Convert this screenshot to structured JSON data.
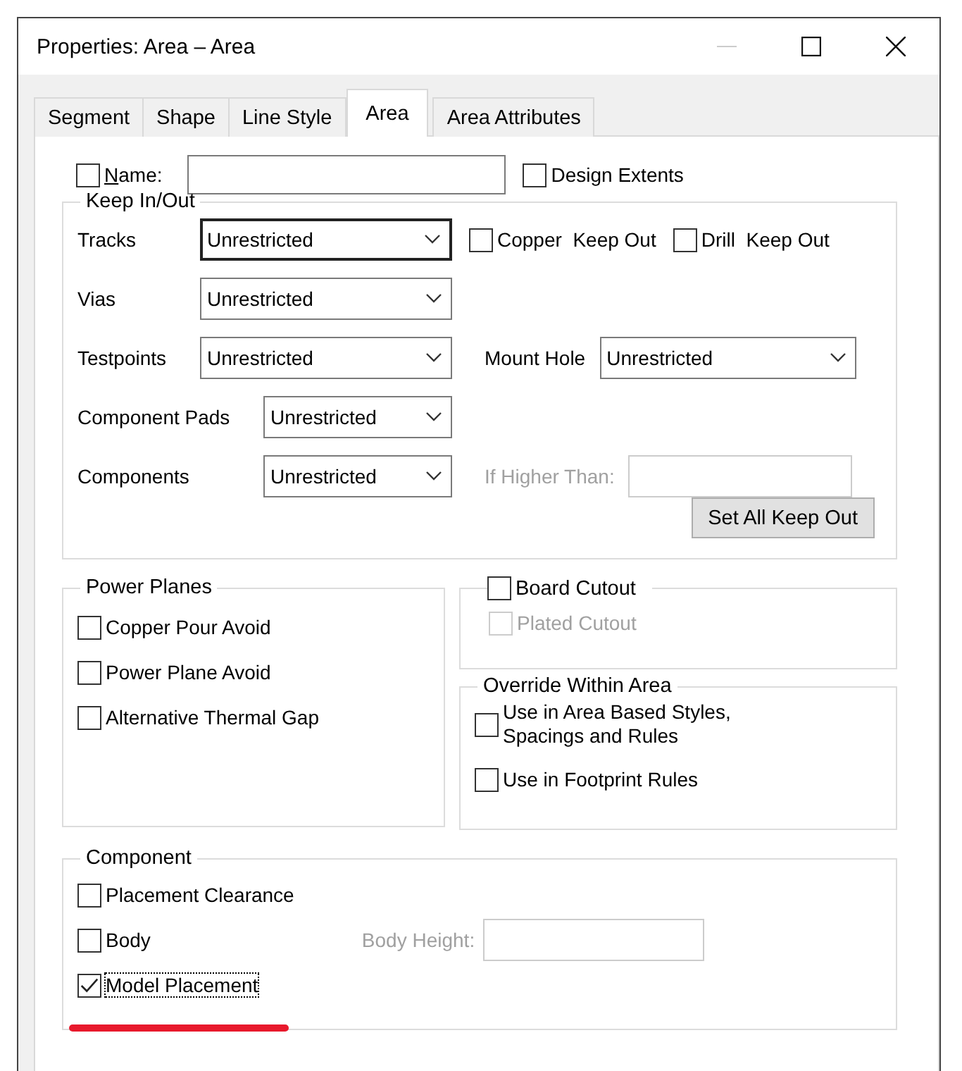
{
  "window": {
    "title": "Properties: Area – Area"
  },
  "title_buttons": [
    {
      "kind": "minimize",
      "disabled": true
    },
    {
      "kind": "maximize",
      "disabled": false
    },
    {
      "kind": "close",
      "disabled": false
    }
  ],
  "tabs": [
    {
      "label": "Segment",
      "selected": false
    },
    {
      "label": "Shape",
      "selected": false
    },
    {
      "label": "Line Style",
      "selected": false
    },
    {
      "label": "Area",
      "selected": true
    },
    {
      "label": "Area Attributes",
      "selected": false
    }
  ],
  "name_row": {
    "name": {
      "label": "Name:",
      "checked": false
    },
    "design_extents": {
      "label": "Design Extents",
      "checked": false
    }
  },
  "keep_in_out": {
    "title": "Keep In/Out",
    "rows": [
      {
        "label": "Tracks",
        "value": "Unrestricted",
        "focused": true,
        "extras": [
          {
            "kind": "checkbox",
            "label": "Copper  Keep Out",
            "checked": false
          },
          {
            "kind": "checkbox",
            "label": "Drill  Keep Out",
            "checked": false
          }
        ]
      },
      {
        "label": "Vias",
        "value": "Unrestricted",
        "focused": false
      },
      {
        "label": "Testpoints",
        "value": "Unrestricted",
        "focused": false,
        "extras": [
          {
            "kind": "combo",
            "label": "Mount Hole",
            "value": "Unrestricted"
          }
        ]
      },
      {
        "label": "Component Pads",
        "value": "Unrestricted",
        "focused": false
      },
      {
        "label": "Components",
        "value": "Unrestricted",
        "focused": false,
        "extras": [
          {
            "kind": "field",
            "label": "If Higher Than:",
            "disabled": true
          }
        ]
      }
    ],
    "button": "Set All Keep Out"
  },
  "power_planes": {
    "title": "Power Planes",
    "items": [
      {
        "label": "Copper Pour Avoid",
        "checked": false
      },
      {
        "label": "Power Plane Avoid",
        "checked": false
      },
      {
        "label": "Alternative Thermal Gap",
        "checked": false
      }
    ]
  },
  "board_cutout": {
    "label": "Board Cutout",
    "checked": false,
    "plated_cutout": {
      "label": "Plated Cutout",
      "checked": false,
      "disabled": true
    }
  },
  "override": {
    "title": "Override Within Area",
    "items": [
      {
        "label": "Use in Area Based Styles,\nSpacings and Rules",
        "checked": false
      },
      {
        "label": "Use in Footprint Rules",
        "checked": false
      }
    ]
  },
  "component": {
    "title": "Component",
    "items": [
      {
        "label": "Placement Clearance",
        "checked": false,
        "focused": false
      },
      {
        "label": "Body",
        "checked": false,
        "focused": false
      },
      {
        "label": "Model Placement",
        "checked": true,
        "focused": true
      }
    ],
    "body_height": {
      "label": "Body Height:",
      "disabled": true
    }
  }
}
